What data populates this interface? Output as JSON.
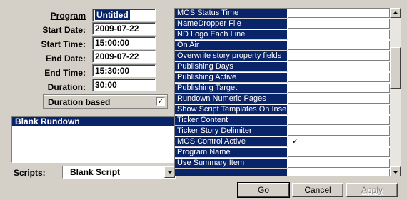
{
  "form": {
    "program_label": "Program",
    "program_value": "Untitled",
    "start_date_label": "Start Date:",
    "start_date_value": "2009-07-22",
    "start_time_label": "Start Time:",
    "start_time_value": "15:00:00",
    "end_date_label": "End Date:",
    "end_date_value": "2009-07-22",
    "end_time_label": "End Time:",
    "end_time_value": "15:30:00",
    "duration_label": "Duration:",
    "duration_value": "30:00",
    "duration_based_label": "Duration based",
    "duration_based_checked": "☑",
    "duration_based_mark": "✓"
  },
  "rundown": {
    "header": "Blank Rundown"
  },
  "scripts": {
    "label": "Scripts:",
    "value": "Blank Script"
  },
  "properties": {
    "rows": [
      {
        "name": "MOS Status Time",
        "value": ""
      },
      {
        "name": "NameDropper File",
        "value": ""
      },
      {
        "name": "ND Logo Each Line",
        "value": ""
      },
      {
        "name": "On Air",
        "value": ""
      },
      {
        "name": "Overwrite story property fields",
        "value": ""
      },
      {
        "name": "Publishing Days",
        "value": ""
      },
      {
        "name": "Publishing Active",
        "value": ""
      },
      {
        "name": "Publishing Target",
        "value": ""
      },
      {
        "name": "Rundown Numeric Pages",
        "value": ""
      },
      {
        "name": "Show Script Templates On Insert",
        "value": ""
      },
      {
        "name": "Ticker Content",
        "value": ""
      },
      {
        "name": "Ticker Story Delimiter",
        "value": ""
      },
      {
        "name": "MOS Control Active",
        "value": "✓"
      },
      {
        "name": "Program Name",
        "value": ""
      },
      {
        "name": "Use Summary Item",
        "value": ""
      }
    ]
  },
  "buttons": {
    "go": "Go",
    "cancel": "Cancel",
    "apply": "Apply"
  }
}
